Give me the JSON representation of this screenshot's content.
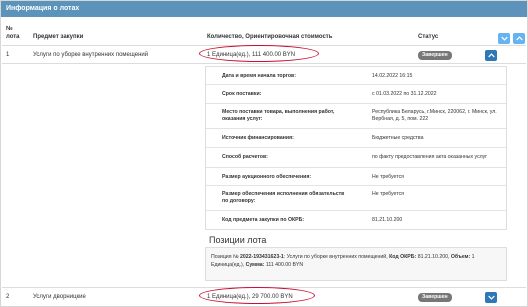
{
  "header": {
    "title": "Информация о лотах"
  },
  "columns": {
    "lot_no": "№ лота",
    "subject": "Предмет закупки",
    "quantity_cost": "Количество, Ориентировочная стоимость",
    "status": "Статус"
  },
  "lots": [
    {
      "no": "1",
      "subject": "Услуги по уборке внутренних помещений",
      "quantity_cost": "1 Единица(ед.), 111 400.00 BYN",
      "status": "Завершен"
    },
    {
      "no": "2",
      "subject": "Услуги дворницкие",
      "quantity_cost": "1 Единица(ед.), 29 700.00 BYN",
      "status": "Завершен"
    }
  ],
  "details": [
    {
      "label": "Дата и время начала торгов:",
      "value": "14.02.2022 16:15"
    },
    {
      "label": "Срок поставки:",
      "value": "с 01.03.2022 по 31.12.2022"
    },
    {
      "label": "Место поставки товара, выполнения работ, оказания услуг:",
      "value": "Республика Беларусь, г.Минск, 220062, г. Минск, ул. Вербная, д. 5, пом. 222"
    },
    {
      "label": "Источник финансирования:",
      "value": "Бюджетные средства"
    },
    {
      "label": "Способ расчетов:",
      "value": "по факту предоставления акта оказанных услуг"
    },
    {
      "label": "Размер аукционного обеспечения:",
      "value": "Не требуется"
    },
    {
      "label": "Размер обеспечения исполнения обязательств по договору:",
      "value": "Не требуется"
    },
    {
      "label": "Код предмета закупки по ОКРБ:",
      "value": "81.21.10.200"
    }
  ],
  "positions": {
    "title": "Позиции лота",
    "line_prefix": "Позиция №",
    "position_id": "2022-193431623-1",
    "position_text": ": Услуги по уборке внутренних помещений,",
    "okrb_label": "Код ОКРБ:",
    "okrb_value": "81.21.10.200,",
    "volume_label": "Объем:",
    "volume_value": "1 Единица(ед.),",
    "sum_label": "Сумма:",
    "sum_value": "111 400.00 BYN"
  },
  "colors": {
    "header_bg": "#5b93bb",
    "button_dark": "#2f77b6",
    "button_light": "#66b3f0",
    "badge_bg": "#777777",
    "highlight_ellipse": "#c8102e"
  }
}
